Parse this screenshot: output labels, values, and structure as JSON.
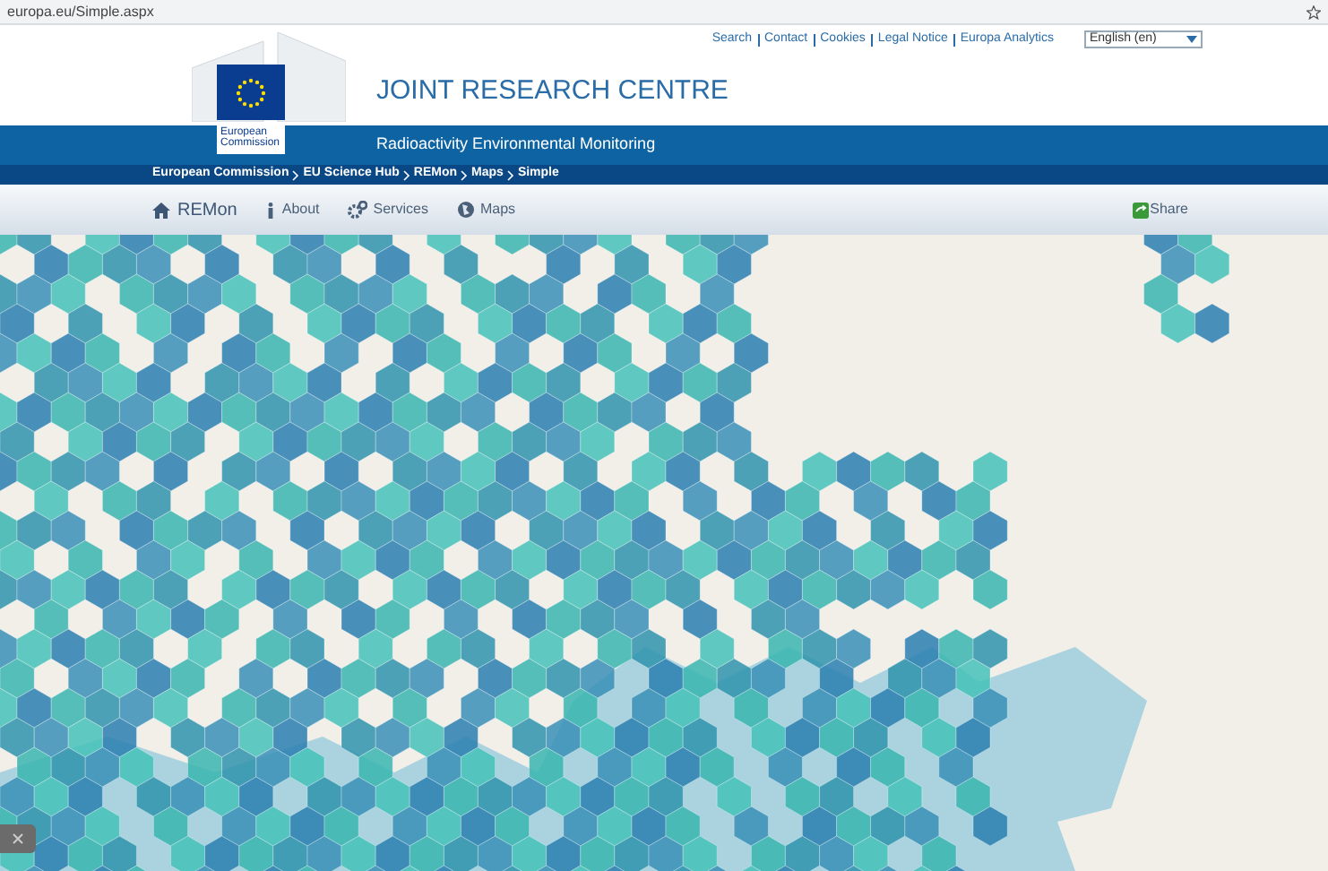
{
  "browser": {
    "address": "europa.eu/Simple.aspx"
  },
  "top_links": [
    "Search",
    "Contact",
    "Cookies",
    "Legal Notice",
    "Europa Analytics"
  ],
  "language_select": {
    "value": "English (en)"
  },
  "logo": {
    "caption": "European Commission"
  },
  "header": {
    "title": "JOINT RESEARCH CENTRE",
    "subtitle": "Radioactivity Environmental Monitoring"
  },
  "breadcrumb": [
    "European Commission",
    "EU Science Hub",
    "REMon",
    "Maps",
    "Simple"
  ],
  "nav": {
    "brand": "REMon",
    "items": [
      {
        "label": "About",
        "kind": "info"
      },
      {
        "label": "Services",
        "kind": "gears"
      },
      {
        "label": "Maps",
        "kind": "globe"
      }
    ],
    "share": "Share"
  }
}
